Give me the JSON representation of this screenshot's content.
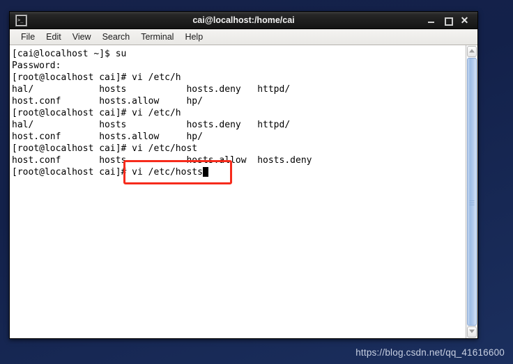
{
  "window": {
    "title": "cai@localhost:/home/cai",
    "icon": "terminal-icon",
    "controls": {
      "minimize": "_",
      "maximize": "□",
      "close": "✕"
    }
  },
  "menu": {
    "items": [
      {
        "label": "File"
      },
      {
        "label": "Edit"
      },
      {
        "label": "View"
      },
      {
        "label": "Search"
      },
      {
        "label": "Terminal"
      },
      {
        "label": "Help"
      }
    ]
  },
  "terminal": {
    "lines": [
      "[cai@localhost ~]$ su",
      "Password:",
      "[root@localhost cai]# vi /etc/h",
      "hal/            hosts           hosts.deny   httpd/",
      "host.conf       hosts.allow     hp/",
      "[root@localhost cai]# vi /etc/h",
      "hal/            hosts           hosts.deny   httpd/",
      "host.conf       hosts.allow     hp/",
      "[root@localhost cai]# vi /etc/host",
      "host.conf       hosts           hosts.allow  hosts.deny"
    ],
    "prompt_line": "[root@localhost cai]# vi /etc/hosts",
    "cursor": "block"
  },
  "scrollbar": {
    "up_arrow": "scroll-up-arrow",
    "down_arrow": "scroll-down-arrow",
    "thumb": "scroll-thumb"
  },
  "annotation": {
    "shape": "rectangle",
    "color": "#f62b1c",
    "target": "[root@localhost cai]# vi /etc/hosts"
  },
  "watermark": {
    "text": "https://blog.csdn.net/qq_41616600"
  }
}
